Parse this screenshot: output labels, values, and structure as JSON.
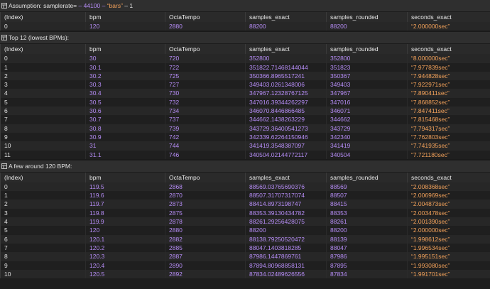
{
  "colors": {
    "background": "#1e1e1e",
    "numeric": "#b58cf5",
    "string": "#f2a15a",
    "header_bar": "#2f2f2f"
  },
  "assumption": {
    "icon": "grid-icon",
    "prefix": "Assumption: samplerate=",
    "samplerate_label": " – 44100 – ",
    "bars_label": "“bars”",
    "bars_suffix": " – 1",
    "columns": [
      "(Index)",
      "bpm",
      "OctaTempo",
      "samples_exact",
      "samples_rounded",
      "seconds_exact"
    ],
    "rows": [
      [
        "0",
        "120",
        "2880",
        "88200",
        "88200",
        "“2.000000sec”"
      ]
    ]
  },
  "top12": {
    "icon": "grid-icon",
    "title": "Top 12 (lowest BPMs):",
    "columns": [
      "(Index)",
      "bpm",
      "OctaTempo",
      "samples_exact",
      "samples_rounded",
      "seconds_exact"
    ],
    "rows": [
      [
        "0",
        "30",
        "720",
        "352800",
        "352800",
        "“8.000000sec”"
      ],
      [
        "1",
        "30.1",
        "722",
        "351822.71468144044",
        "351823",
        "“7.977839sec”"
      ],
      [
        "2",
        "30.2",
        "725",
        "350366.8965517241",
        "350367",
        "“7.944828sec”"
      ],
      [
        "3",
        "30.3",
        "727",
        "349403.0261348006",
        "349403",
        "“7.922971sec”"
      ],
      [
        "4",
        "30.4",
        "730",
        "347967.12328767125",
        "347967",
        "“7.890411sec”"
      ],
      [
        "5",
        "30.5",
        "732",
        "347016.39344262297",
        "347016",
        "“7.868852sec”"
      ],
      [
        "6",
        "30.6",
        "734",
        "346070.8446866485",
        "346071",
        "“7.847411sec”"
      ],
      [
        "7",
        "30.7",
        "737",
        "344662.1438263229",
        "344662",
        "“7.815468sec”"
      ],
      [
        "8",
        "30.8",
        "739",
        "343729.36400541273",
        "343729",
        "“7.794317sec”"
      ],
      [
        "9",
        "30.9",
        "742",
        "342339.62264150946",
        "342340",
        "“7.762803sec”"
      ],
      [
        "10",
        "31",
        "744",
        "341419.3548387097",
        "341419",
        "“7.741935sec”"
      ],
      [
        "11",
        "31.1",
        "746",
        "340504.02144772117",
        "340504",
        "“7.721180sec”"
      ]
    ]
  },
  "around120": {
    "icon": "grid-icon",
    "title": "A few around 120 BPM:",
    "columns": [
      "(Index)",
      "bpm",
      "OctaTempo",
      "samples_exact",
      "samples_rounded",
      "seconds_exact"
    ],
    "rows": [
      [
        "0",
        "119.5",
        "2868",
        "88569.03765690376",
        "88569",
        "“2.008368sec”"
      ],
      [
        "1",
        "119.6",
        "2870",
        "88507.31707317074",
        "88507",
        "“2.006969sec”"
      ],
      [
        "2",
        "119.7",
        "2873",
        "88414.8973198747",
        "88415",
        "“2.004873sec”"
      ],
      [
        "3",
        "119.8",
        "2875",
        "88353.39130434782",
        "88353",
        "“2.003478sec”"
      ],
      [
        "4",
        "119.9",
        "2878",
        "88261.29256428075",
        "88261",
        "“2.001390sec”"
      ],
      [
        "5",
        "120",
        "2880",
        "88200",
        "88200",
        "“2.000000sec”"
      ],
      [
        "6",
        "120.1",
        "2882",
        "88138.79250520472",
        "88139",
        "“1.998612sec”"
      ],
      [
        "7",
        "120.2",
        "2885",
        "88047.1403818285",
        "88047",
        "“1.996534sec”"
      ],
      [
        "8",
        "120.3",
        "2887",
        "87986.1447869761",
        "87986",
        "“1.995151sec”"
      ],
      [
        "9",
        "120.4",
        "2890",
        "87894.80968858131",
        "87895",
        "“1.993080sec”"
      ],
      [
        "10",
        "120.5",
        "2892",
        "87834.02489626556",
        "87834",
        "“1.991701sec”"
      ]
    ]
  }
}
